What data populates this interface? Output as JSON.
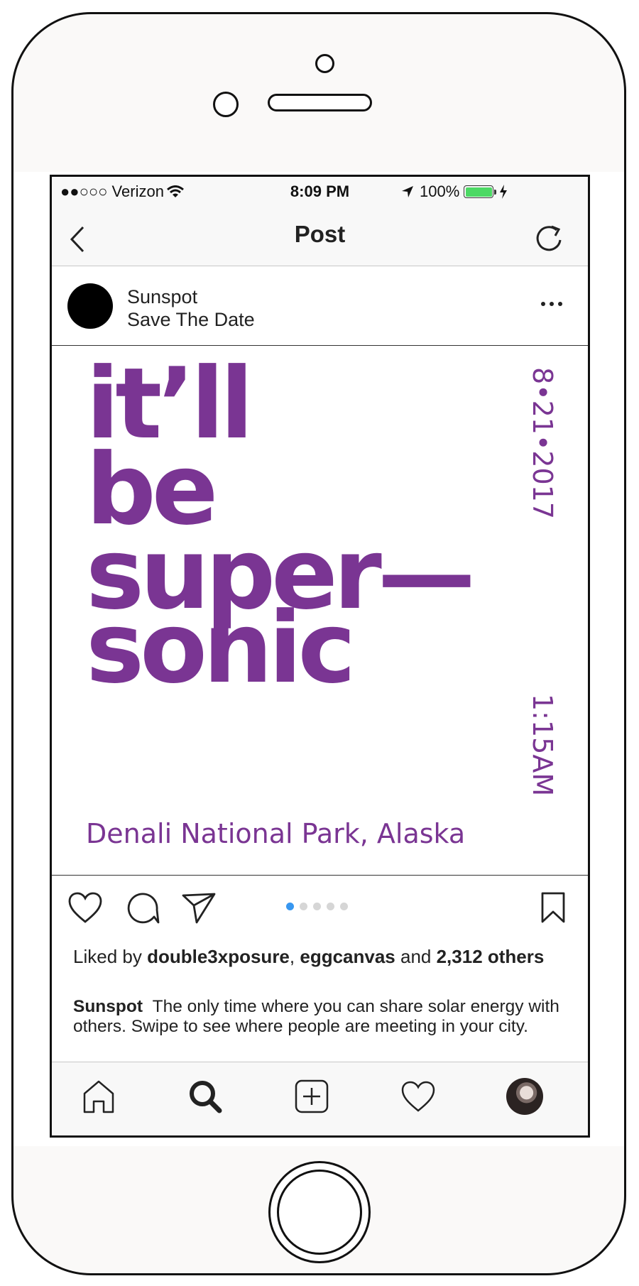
{
  "status_bar": {
    "carrier": "●●○○○ Verizon",
    "time": "8:09 PM",
    "battery": "100%"
  },
  "nav": {
    "title": "Post"
  },
  "post": {
    "username": "Sunspot",
    "subtitle": "Save The Date",
    "image": {
      "headline_lines": [
        "it’ll",
        "be",
        "super—",
        "sonic"
      ],
      "date": "8•21•2017",
      "time": "1:15AM",
      "location": "Denali National Park, Alaska",
      "accent_color": "#7a3593"
    },
    "carousel": {
      "total": 5,
      "active": 1
    },
    "likes": {
      "prefix": "Liked by ",
      "user1": "double3xposure",
      "sep": ", ",
      "user2": "eggcanvas",
      "and": " and ",
      "count": "2,312 others"
    },
    "caption": {
      "user": "Sunspot",
      "text": "The only time where you can share solar energy with others. Swipe to see where people are meeting in your city."
    }
  },
  "icons": {
    "status": [
      "wifi-icon",
      "location-arrow-icon",
      "battery-icon",
      "charging-icon"
    ],
    "nav": [
      "back-chevron-icon",
      "refresh-icon"
    ],
    "actions": [
      "heart-icon",
      "comment-icon",
      "share-icon",
      "bookmark-icon"
    ],
    "tabs": [
      "home-icon",
      "search-icon",
      "add-post-icon",
      "activity-heart-icon",
      "profile-avatar"
    ]
  }
}
